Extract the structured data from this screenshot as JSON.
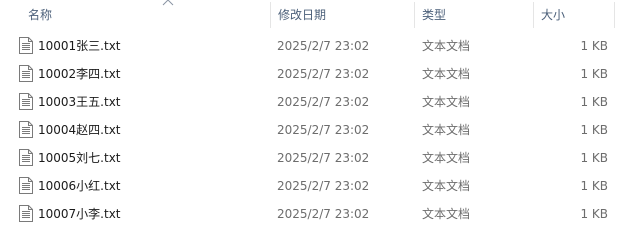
{
  "columns": {
    "name": "名称",
    "date": "修改日期",
    "type": "类型",
    "size": "大小"
  },
  "files": [
    {
      "name": "10001张三.txt",
      "date": "2025/2/7 23:02",
      "type": "文本文档",
      "size": "1 KB"
    },
    {
      "name": "10002李四.txt",
      "date": "2025/2/7 23:02",
      "type": "文本文档",
      "size": "1 KB"
    },
    {
      "name": "10003王五.txt",
      "date": "2025/2/7 23:02",
      "type": "文本文档",
      "size": "1 KB"
    },
    {
      "name": "10004赵四.txt",
      "date": "2025/2/7 23:02",
      "type": "文本文档",
      "size": "1 KB"
    },
    {
      "name": "10005刘七.txt",
      "date": "2025/2/7 23:02",
      "type": "文本文档",
      "size": "1 KB"
    },
    {
      "name": "10006小红.txt",
      "date": "2025/2/7 23:02",
      "type": "文本文档",
      "size": "1 KB"
    },
    {
      "name": "10007小李.txt",
      "date": "2025/2/7 23:02",
      "type": "文本文档",
      "size": "1 KB"
    }
  ],
  "file_icon": "text-file-icon",
  "sort_icon": "sort-ascending-icon"
}
